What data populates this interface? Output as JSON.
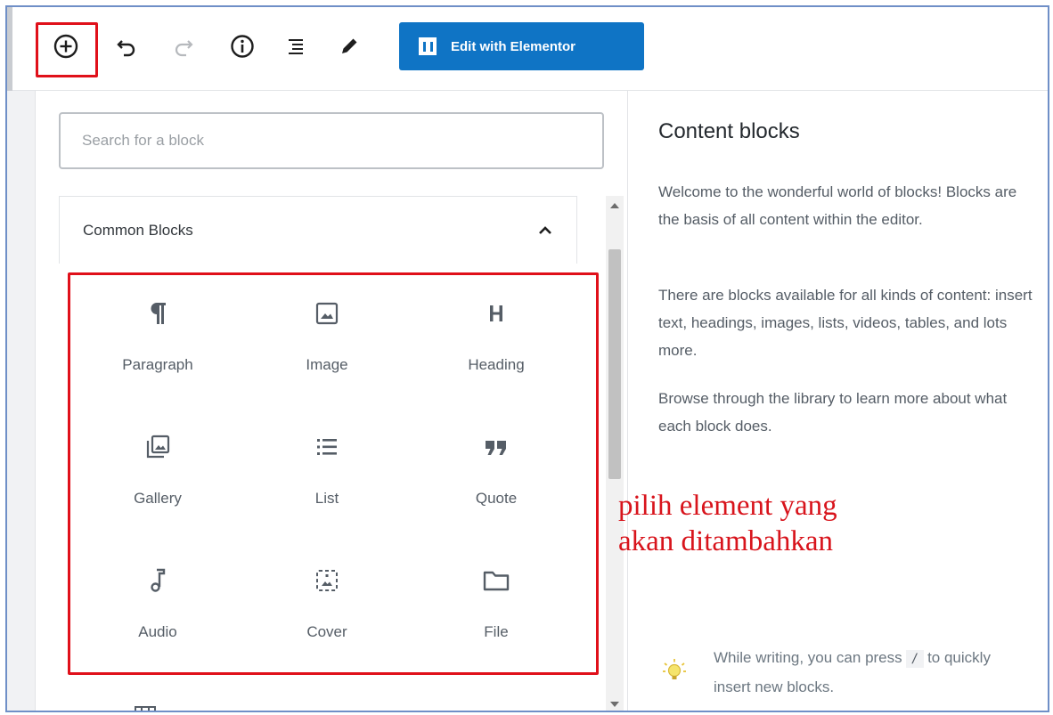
{
  "toolbar": {
    "add_icon": "plus-circle-icon",
    "undo_icon": "undo-icon",
    "redo_icon": "redo-icon",
    "info_icon": "info-icon",
    "outline_icon": "list-outline-icon",
    "tools_icon": "pencil-icon",
    "elementor_label": "Edit with Elementor",
    "elementor_color": "#0f74c5"
  },
  "inserter": {
    "search_placeholder": "Search for a block",
    "category_title": "Common Blocks",
    "blocks": [
      {
        "label": "Paragraph",
        "icon": "paragraph-icon"
      },
      {
        "label": "Image",
        "icon": "image-icon"
      },
      {
        "label": "Heading",
        "icon": "heading-icon"
      },
      {
        "label": "Gallery",
        "icon": "gallery-icon"
      },
      {
        "label": "List",
        "icon": "list-icon"
      },
      {
        "label": "Quote",
        "icon": "quote-icon"
      },
      {
        "label": "Audio",
        "icon": "audio-icon"
      },
      {
        "label": "Cover",
        "icon": "cover-icon"
      },
      {
        "label": "File",
        "icon": "folder-icon"
      }
    ]
  },
  "help": {
    "title": "Content blocks",
    "p1": "Welcome to the wonderful world of blocks! Blocks are the basis of all content within the editor.",
    "p2": "There are blocks available for all kinds of content: insert text, headings, images, lists, videos, tables, and lots more.",
    "p3": "Browse through the library to learn more about what each block does.",
    "tip_before": "While writing, you can press",
    "tip_key": "/",
    "tip_after": "to quickly insert new blocks."
  },
  "annotation": {
    "line1": "pilih element yang",
    "line2": "akan ditambahkan",
    "color": "#d8141c"
  }
}
